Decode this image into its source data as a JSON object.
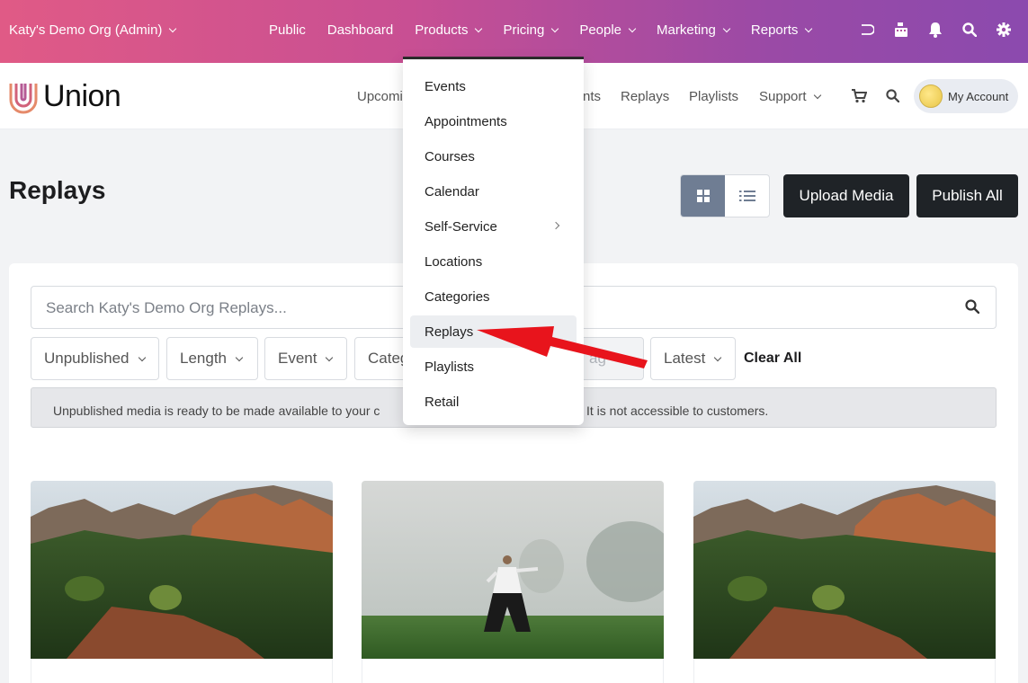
{
  "admin_bar": {
    "org_label": "Katy's Demo Org (Admin)",
    "nav": [
      {
        "label": "Public",
        "has_caret": false
      },
      {
        "label": "Dashboard",
        "has_caret": false
      },
      {
        "label": "Products",
        "has_caret": true
      },
      {
        "label": "Pricing",
        "has_caret": true
      },
      {
        "label": "People",
        "has_caret": true
      },
      {
        "label": "Marketing",
        "has_caret": true
      },
      {
        "label": "Reports",
        "has_caret": true
      }
    ],
    "icons": [
      "exit-icon",
      "cash-register-icon",
      "bell-icon",
      "search-icon",
      "gear-icon"
    ]
  },
  "site_header": {
    "brand": "Union",
    "nav": {
      "upcoming": "Upcomi",
      "events": "nts",
      "replays": "Replays",
      "playlists": "Playlists",
      "support": "Support"
    },
    "account_label": "My Account"
  },
  "page": {
    "title": "Replays",
    "upload_button": "Upload Media",
    "publish_button": "Publish All"
  },
  "search": {
    "placeholder": "Search Katy's Demo Org Replays..."
  },
  "filters": {
    "status": "Unpublished",
    "length": "Length",
    "event": "Event",
    "category": "Categ",
    "tag": "ag",
    "sort": "Latest",
    "clear_all": "Clear All"
  },
  "notice": {
    "left_text": "Unpublished media is ready to be made available to your c",
    "right_text": "It is not accessible to customers."
  },
  "products_menu": {
    "items": [
      {
        "label": "Events",
        "has_submenu": false
      },
      {
        "label": "Appointments",
        "has_submenu": false
      },
      {
        "label": "Courses",
        "has_submenu": false
      },
      {
        "label": "Calendar",
        "has_submenu": false
      },
      {
        "label": "Self-Service",
        "has_submenu": true
      },
      {
        "label": "Locations",
        "has_submenu": false
      },
      {
        "label": "Categories",
        "has_submenu": false
      },
      {
        "label": "Replays",
        "has_submenu": false,
        "highlighted": true
      },
      {
        "label": "Playlists",
        "has_submenu": false
      },
      {
        "label": "Retail",
        "has_submenu": false
      }
    ]
  },
  "thumbnails": [
    {
      "scene": "red rock canyon landscape"
    },
    {
      "scene": "person practicing tai chi in foggy field"
    },
    {
      "scene": "red rock canyon landscape"
    }
  ],
  "colors": {
    "admin_gradient_start": "#e05a86",
    "admin_gradient_end": "#8b4aae",
    "dark_button": "#1f2327",
    "toggle_active": "#6f7d93",
    "annotation_arrow": "#e8141c"
  }
}
